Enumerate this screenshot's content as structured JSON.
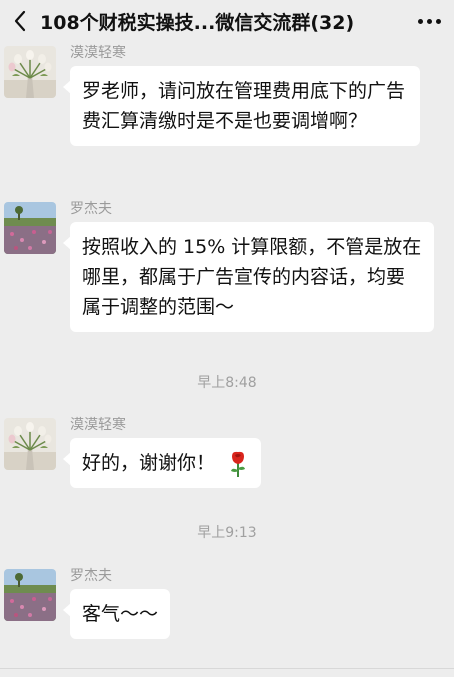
{
  "header": {
    "title": "108个财税实操技...微信交流群(32)",
    "back_icon": "chevron-left-icon",
    "more_icon": "more-dots-icon"
  },
  "messages": [
    {
      "sender": "漠漠轻寒",
      "avatar": "tulips-avatar",
      "text": "罗老师，请问放在管理费用底下的广告费汇算清缴时是不是也要调增啊？"
    },
    {
      "sender": "罗杰夫",
      "avatar": "landscape-avatar",
      "text": "按照收入的 15% 计算限额，不管是放在哪里，都属于广告宣传的内容话，均要属于调整的范围～"
    },
    {
      "sender": "漠漠轻寒",
      "avatar": "tulips-avatar",
      "text": "好的，谢谢你！",
      "emoji": "rose-icon"
    },
    {
      "sender": "罗杰夫",
      "avatar": "landscape-avatar",
      "text": "客气～～"
    }
  ],
  "timestamps": [
    "早上8:48",
    "早上9:13"
  ],
  "colors": {
    "background": "#ededed",
    "bubble": "#ffffff",
    "sender_text": "#9a9a9a",
    "timestamp_text": "#a0a0a0"
  }
}
